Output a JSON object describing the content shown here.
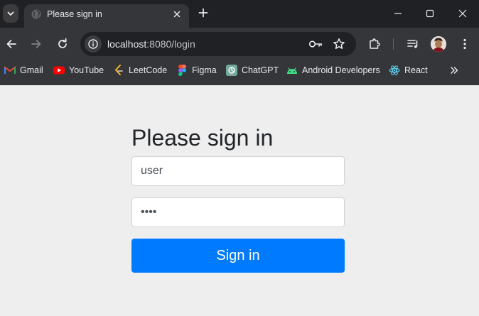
{
  "browser": {
    "tab": {
      "title": "Please sign in"
    },
    "address_bar": {
      "host": "localhost",
      "path": ":8080/login"
    },
    "bookmarks": [
      {
        "label": "Gmail",
        "icon": "gmail-icon"
      },
      {
        "label": "YouTube",
        "icon": "youtube-icon"
      },
      {
        "label": "LeetCode",
        "icon": "leetcode-icon"
      },
      {
        "label": "Figma",
        "icon": "figma-icon"
      },
      {
        "label": "ChatGPT",
        "icon": "chatgpt-icon"
      },
      {
        "label": "Android Developers",
        "icon": "android-icon"
      },
      {
        "label": "React",
        "icon": "react-icon"
      }
    ]
  },
  "login": {
    "heading": "Please sign in",
    "username_value": "user",
    "password_value": "••••",
    "submit_label": "Sign in"
  },
  "colors": {
    "primary_button": "#007bff",
    "page_background": "#eeeeee",
    "browser_frame": "#202124",
    "toolbar": "#35363a"
  }
}
